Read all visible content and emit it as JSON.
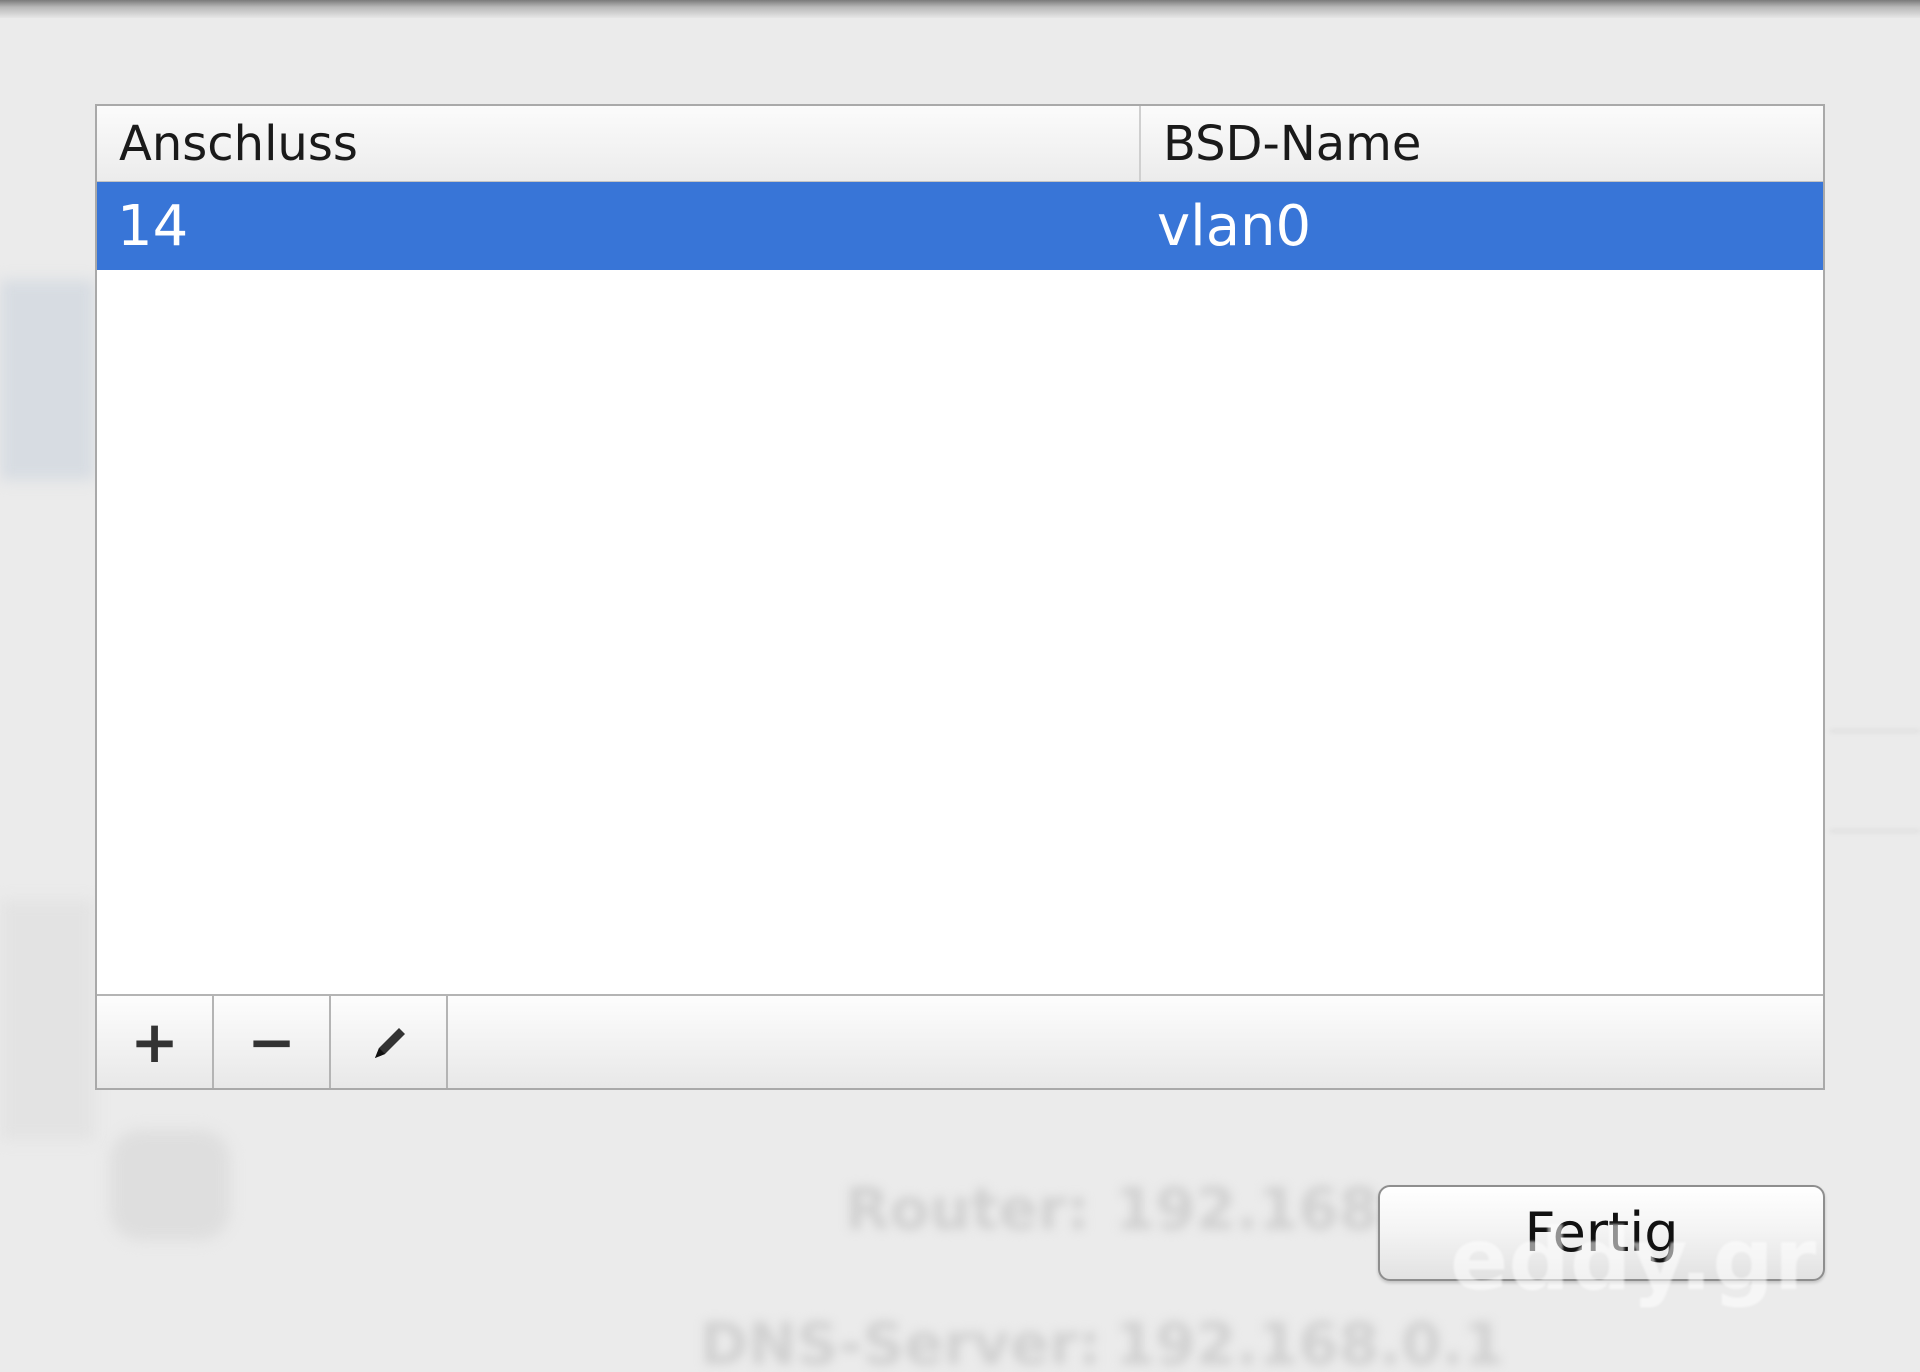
{
  "table": {
    "columns": [
      "Anschluss",
      "BSD-Name"
    ],
    "rows": [
      {
        "anschluss": "14",
        "bsd_name": "vlan0",
        "selected": true
      }
    ]
  },
  "toolbar": {
    "add_glyph": "+",
    "remove_glyph": "−",
    "add_icon": "plus-icon",
    "remove_icon": "minus-icon",
    "edit_icon": "pencil-icon"
  },
  "done_button": {
    "label": "Fertig"
  },
  "background": {
    "router_label": "Router:",
    "router_value": "192.168.",
    "dns_label": "DNS-Server:",
    "dns_value": "192.168.0.1"
  },
  "watermark": "eddy.gr",
  "colors": {
    "selection": "#3875d7",
    "window_background": "#ebebeb"
  }
}
